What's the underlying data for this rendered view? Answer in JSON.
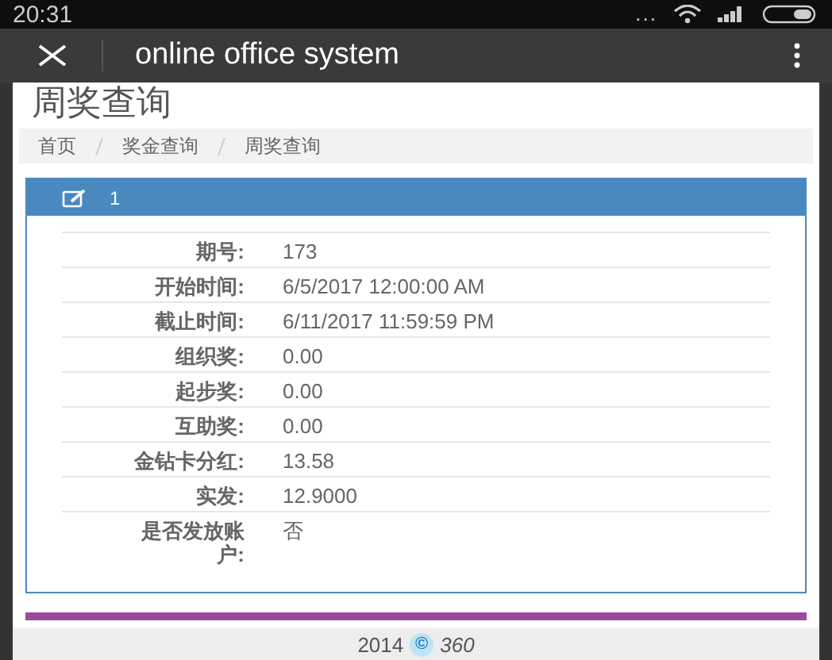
{
  "status_bar": {
    "time": "20:31",
    "more": "..."
  },
  "app_bar": {
    "title": "online office system"
  },
  "page": {
    "title": "周奖查询"
  },
  "breadcrumb": [
    {
      "label": "首页"
    },
    {
      "label": "奖金查询"
    },
    {
      "label": "周奖查询"
    }
  ],
  "panel": {
    "title": "1",
    "rows": [
      {
        "label": "期号:",
        "value": "173"
      },
      {
        "label": "开始时间:",
        "value": "6/5/2017 12:00:00 AM"
      },
      {
        "label": "截止时间:",
        "value": "6/11/2017 11:59:59 PM"
      },
      {
        "label": "组织奖:",
        "value": "0.00"
      },
      {
        "label": "起步奖:",
        "value": "0.00"
      },
      {
        "label": "互助奖:",
        "value": "0.00"
      },
      {
        "label": "金钻卡分红:",
        "value": "13.58"
      },
      {
        "label": "实发:",
        "value": "12.9000"
      },
      {
        "label": "是否发放账户:",
        "value": "否"
      }
    ]
  },
  "footer": {
    "year": "2014",
    "symbol": "©",
    "brand": "360"
  }
}
